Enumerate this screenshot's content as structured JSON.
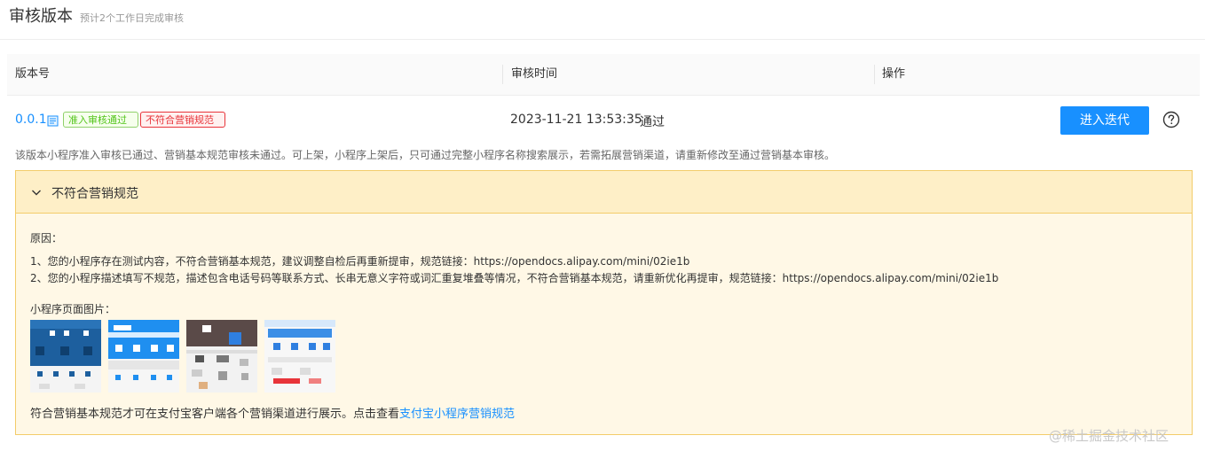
{
  "header": {
    "title": "审核版本",
    "subtitle": "预计2个工作日完成审核"
  },
  "table": {
    "columns": [
      "版本号",
      "审核时间",
      "操作"
    ]
  },
  "row": {
    "version": "0.0.1",
    "tag_passed": "准入审核通过",
    "tag_failed": "不符合营销规范",
    "review_time": "2023-11-21 13:53:35",
    "review_status": "通过",
    "action_button": "进入迭代"
  },
  "notice": "该版本小程序准入审核已通过、营销基本规范审核未通过。可上架，小程序上架后，只可通过完整小程序名称搜索展示，若需拓展营销渠道，请重新修改至通过营销基本审核。",
  "panel": {
    "title": "不符合营销规范",
    "reason_label": "原因：",
    "reasons": [
      "1、您的小程序存在测试内容，不符合营销基本规范，建议调整自检后再重新提审，规范链接：https://opendocs.alipay.com/mini/02ie1b",
      "2、您的小程序描述填写不规范，描述包含电话号码等联系方式、长串无意义字符或词汇重复堆叠等情况，不符合营销基本规范，请重新优化再提审，规范链接：https://opendocs.alipay.com/mini/02ie1b"
    ],
    "images_label": "小程序页面图片：",
    "footer_text": "符合营销基本规范才可在支付宝客户端各个营销渠道进行展示。点击查看",
    "footer_link": "支付宝小程序营销规范"
  },
  "watermark": "@稀土掘金技术社区",
  "colors": {
    "link": "#1890ff",
    "success": "#52c41a",
    "danger": "#e8343a",
    "warning_border": "#f3cc6a",
    "warning_bg": "#fff8e6"
  },
  "icons": {
    "doc": "doc-icon",
    "help": "question-circle-icon",
    "chevron": "chevron-down-icon"
  }
}
